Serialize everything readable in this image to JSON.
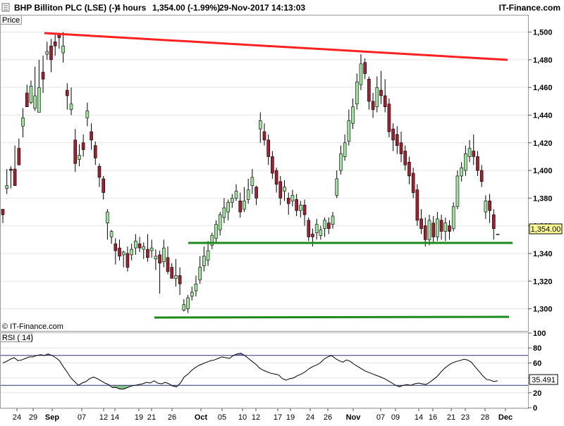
{
  "header": {
    "instrument": "BHP Billiton PLC (LSE) (-)",
    "interval": "4 hours",
    "last": "1,354.00 (-1.99%)",
    "datetime": "29-Nov-2017 14:13:03",
    "brand": "IT-Finance.com"
  },
  "price_panel": {
    "label": "Price",
    "copyright": "© IT-Finance.com",
    "last_price_tag": "1,354.00",
    "yticks": [
      "1,300",
      "1,320",
      "1,340",
      "1,360",
      "1,380",
      "1,400",
      "1,420",
      "1,440",
      "1,460",
      "1,480",
      "1,500"
    ]
  },
  "rsi_panel": {
    "label": "RSI ( 14)",
    "value_tag": "35.491",
    "yticks": [
      "0",
      "20",
      "40",
      "60",
      "80",
      "100"
    ]
  },
  "xaxis": {
    "labels": [
      {
        "text": "24",
        "bold": false
      },
      {
        "text": "29",
        "bold": false
      },
      {
        "text": "Sep",
        "bold": true
      },
      {
        "text": "07",
        "bold": false
      },
      {
        "text": "12",
        "bold": false
      },
      {
        "text": "14",
        "bold": false
      },
      {
        "text": "19",
        "bold": false
      },
      {
        "text": "21",
        "bold": false
      },
      {
        "text": "26",
        "bold": false
      },
      {
        "text": "Oct",
        "bold": true
      },
      {
        "text": "05",
        "bold": false
      },
      {
        "text": "10",
        "bold": false
      },
      {
        "text": "12",
        "bold": false
      },
      {
        "text": "17",
        "bold": false
      },
      {
        "text": "19",
        "bold": false
      },
      {
        "text": "24",
        "bold": false
      },
      {
        "text": "26",
        "bold": false
      },
      {
        "text": "Nov",
        "bold": true
      },
      {
        "text": "07",
        "bold": false
      },
      {
        "text": "09",
        "bold": false
      },
      {
        "text": "14",
        "bold": false
      },
      {
        "text": "16",
        "bold": false
      },
      {
        "text": "21",
        "bold": false
      },
      {
        "text": "23",
        "bold": false
      },
      {
        "text": "28",
        "bold": false
      },
      {
        "text": "Dec",
        "bold": true
      }
    ]
  },
  "colors": {
    "up_candle": "#9ee29e",
    "down_candle": "#a02030",
    "resistance_line": "#ff2020",
    "support_line": "#1a8a1a",
    "rsi_line": "#000000",
    "rsi_overbought_fill": "#9a8ad6",
    "rsi_oversold_fill": "#88c488",
    "level_lines": "#303070",
    "grid": "#e4e4e4"
  },
  "chart_data": [
    {
      "type": "candlestick",
      "title": "BHP Billiton PLC (LSE) (-)",
      "ylim": [
        1284,
        1512
      ],
      "yticks": [
        1300,
        1320,
        1340,
        1360,
        1380,
        1400,
        1420,
        1440,
        1460,
        1480,
        1500
      ],
      "last_price": 1354.0,
      "candles": [
        [
          1372,
          1368,
          1368,
          1362
        ],
        [
          1387,
          1389,
          1401,
          1383
        ],
        [
          1401,
          1400,
          1403,
          1387
        ],
        [
          1401,
          1389,
          1418,
          1389
        ],
        [
          1416,
          1404,
          1423,
          1406
        ],
        [
          1432,
          1438,
          1445,
          1424
        ],
        [
          1456,
          1446,
          1462,
          1450
        ],
        [
          1449,
          1461,
          1465,
          1448
        ],
        [
          1445,
          1454,
          1475,
          1443
        ],
        [
          1442,
          1460,
          1480,
          1446
        ],
        [
          1471,
          1466,
          1483,
          1456
        ],
        [
          1484,
          1486,
          1493,
          1480
        ],
        [
          1490,
          1480,
          1495,
          1471
        ],
        [
          1493,
          1490,
          1498,
          1483
        ],
        [
          1499,
          1496,
          1499,
          1488
        ],
        [
          1485,
          1490,
          1500,
          1478
        ],
        [
          1458,
          1454,
          1463,
          1444
        ],
        [
          1444,
          1448,
          1460,
          1440
        ],
        [
          1422,
          1405,
          1430,
          1399
        ],
        [
          1408,
          1411,
          1419,
          1403
        ],
        [
          1420,
          1415,
          1426,
          1410
        ],
        [
          1438,
          1443,
          1449,
          1432
        ],
        [
          1428,
          1422,
          1434,
          1415
        ],
        [
          1418,
          1409,
          1421,
          1404
        ],
        [
          1403,
          1395,
          1405,
          1388
        ],
        [
          1394,
          1384,
          1396,
          1379
        ],
        [
          1362,
          1370,
          1372,
          1350
        ],
        [
          1352,
          1356,
          1357,
          1347
        ],
        [
          1347,
          1342,
          1351,
          1332
        ],
        [
          1344,
          1338,
          1350,
          1335
        ],
        [
          1339,
          1341,
          1342,
          1330
        ],
        [
          1340,
          1330,
          1345,
          1327
        ],
        [
          1339,
          1343,
          1347,
          1335
        ],
        [
          1344,
          1349,
          1354,
          1339
        ],
        [
          1347,
          1344,
          1352,
          1341
        ],
        [
          1343,
          1345,
          1348,
          1336
        ],
        [
          1343,
          1337,
          1354,
          1334
        ],
        [
          1342,
          1344,
          1350,
          1337
        ],
        [
          1336,
          1338,
          1343,
          1328
        ],
        [
          1339,
          1333,
          1342,
          1311
        ],
        [
          1334,
          1344,
          1350,
          1330
        ],
        [
          1337,
          1327,
          1345,
          1325
        ],
        [
          1330,
          1322,
          1333,
          1322
        ],
        [
          1322,
          1324,
          1336,
          1316
        ],
        [
          1324,
          1318,
          1330,
          1310
        ],
        [
          1299,
          1303,
          1307,
          1298
        ],
        [
          1300,
          1308,
          1310,
          1297
        ],
        [
          1309,
          1312,
          1316,
          1306
        ],
        [
          1313,
          1318,
          1324,
          1309
        ],
        [
          1321,
          1330,
          1338,
          1318
        ],
        [
          1331,
          1338,
          1345,
          1327
        ],
        [
          1335,
          1342,
          1349,
          1331
        ],
        [
          1346,
          1353,
          1355,
          1343
        ],
        [
          1351,
          1361,
          1364,
          1348
        ],
        [
          1357,
          1368,
          1370,
          1353
        ],
        [
          1366,
          1373,
          1380,
          1362
        ],
        [
          1370,
          1377,
          1379,
          1364
        ],
        [
          1377,
          1380,
          1383,
          1373
        ],
        [
          1380,
          1385,
          1390,
          1378
        ],
        [
          1378,
          1370,
          1384,
          1366
        ],
        [
          1372,
          1378,
          1388,
          1370
        ],
        [
          1379,
          1386,
          1394,
          1376
        ],
        [
          1389,
          1395,
          1401,
          1383
        ],
        [
          1388,
          1380,
          1389,
          1375
        ],
        [
          1430,
          1436,
          1442,
          1420
        ],
        [
          1428,
          1422,
          1434,
          1418
        ],
        [
          1422,
          1410,
          1426,
          1404
        ],
        [
          1410,
          1398,
          1414,
          1394
        ],
        [
          1400,
          1390,
          1402,
          1384
        ],
        [
          1392,
          1380,
          1396,
          1375
        ],
        [
          1385,
          1388,
          1393,
          1378
        ],
        [
          1380,
          1376,
          1384,
          1368
        ],
        [
          1378,
          1382,
          1386,
          1374
        ],
        [
          1379,
          1371,
          1383,
          1367
        ],
        [
          1371,
          1375,
          1378,
          1366
        ],
        [
          1375,
          1368,
          1379,
          1360
        ],
        [
          1364,
          1352,
          1366,
          1349
        ],
        [
          1354,
          1352,
          1358,
          1345
        ],
        [
          1355,
          1361,
          1365,
          1350
        ],
        [
          1353,
          1357,
          1360,
          1350
        ],
        [
          1358,
          1364,
          1366,
          1352
        ],
        [
          1362,
          1358,
          1366,
          1354
        ],
        [
          1361,
          1367,
          1370,
          1358
        ],
        [
          1382,
          1394,
          1400,
          1380
        ],
        [
          1400,
          1412,
          1418,
          1397
        ],
        [
          1410,
          1420,
          1426,
          1407
        ],
        [
          1421,
          1436,
          1444,
          1418
        ],
        [
          1434,
          1446,
          1452,
          1430
        ],
        [
          1448,
          1464,
          1470,
          1444
        ],
        [
          1462,
          1477,
          1484,
          1458
        ],
        [
          1478,
          1470,
          1481,
          1466
        ],
        [
          1466,
          1450,
          1468,
          1444
        ],
        [
          1450,
          1444,
          1456,
          1438
        ],
        [
          1446,
          1460,
          1468,
          1442
        ],
        [
          1458,
          1454,
          1472,
          1448
        ],
        [
          1454,
          1446,
          1466,
          1442
        ],
        [
          1448,
          1428,
          1452,
          1424
        ],
        [
          1430,
          1422,
          1434,
          1414
        ],
        [
          1426,
          1418,
          1432,
          1412
        ],
        [
          1420,
          1412,
          1428,
          1406
        ],
        [
          1414,
          1404,
          1418,
          1400
        ],
        [
          1406,
          1396,
          1410,
          1390
        ],
        [
          1398,
          1384,
          1402,
          1380
        ],
        [
          1386,
          1364,
          1390,
          1360
        ],
        [
          1365,
          1358,
          1372,
          1354
        ],
        [
          1360,
          1350,
          1366,
          1345
        ],
        [
          1350,
          1364,
          1368,
          1346
        ],
        [
          1362,
          1352,
          1367,
          1348
        ],
        [
          1352,
          1365,
          1370,
          1349
        ],
        [
          1364,
          1356,
          1368,
          1350
        ],
        [
          1356,
          1362,
          1366,
          1349
        ],
        [
          1360,
          1356,
          1364,
          1350
        ],
        [
          1358,
          1374,
          1377,
          1356
        ],
        [
          1374,
          1396,
          1400,
          1372
        ],
        [
          1396,
          1402,
          1406,
          1392
        ],
        [
          1400,
          1412,
          1418,
          1396
        ],
        [
          1410,
          1416,
          1422,
          1406
        ],
        [
          1414,
          1410,
          1426,
          1404
        ],
        [
          1410,
          1400,
          1414,
          1396
        ],
        [
          1400,
          1392,
          1404,
          1388
        ],
        [
          1370,
          1378,
          1382,
          1365
        ],
        [
          1378,
          1371,
          1383,
          1362
        ],
        [
          1368,
          1358,
          1372,
          1350
        ],
        [
          1354,
          1354,
          1354,
          1354
        ]
      ]
    },
    {
      "type": "line",
      "title": "RSI ( 14)",
      "ylim": [
        0,
        100
      ],
      "yticks": [
        0,
        20,
        40,
        60,
        80,
        100
      ],
      "levels": [
        70,
        30
      ],
      "last_value": 35.491,
      "values": [
        60,
        62,
        65,
        67,
        63,
        64,
        66,
        68,
        68,
        70,
        71,
        70,
        72,
        70,
        67,
        63,
        55,
        48,
        40,
        35,
        30,
        33,
        35,
        39,
        41,
        39,
        36,
        33,
        31,
        27,
        27,
        25,
        25,
        27,
        29,
        30,
        31,
        32,
        34,
        33,
        36,
        33,
        32,
        34,
        32,
        29,
        28,
        33,
        41,
        45,
        50,
        54,
        57,
        59,
        61,
        63,
        64,
        66,
        68,
        67,
        66,
        70,
        72,
        73,
        70,
        66,
        62,
        58,
        53,
        50,
        48,
        46,
        45,
        44,
        39,
        37,
        39,
        40,
        43,
        45,
        48,
        52,
        55,
        57,
        60,
        65,
        68,
        70,
        66,
        63,
        61,
        64,
        62,
        58,
        55,
        52,
        49,
        47,
        45,
        43,
        41,
        39,
        36,
        33,
        30,
        28,
        30,
        31,
        30,
        32,
        33,
        32,
        31,
        34,
        38,
        42,
        48,
        53,
        57,
        60,
        62,
        63,
        65,
        64,
        61,
        55,
        49,
        43,
        38,
        37,
        35,
        36
      ]
    }
  ]
}
